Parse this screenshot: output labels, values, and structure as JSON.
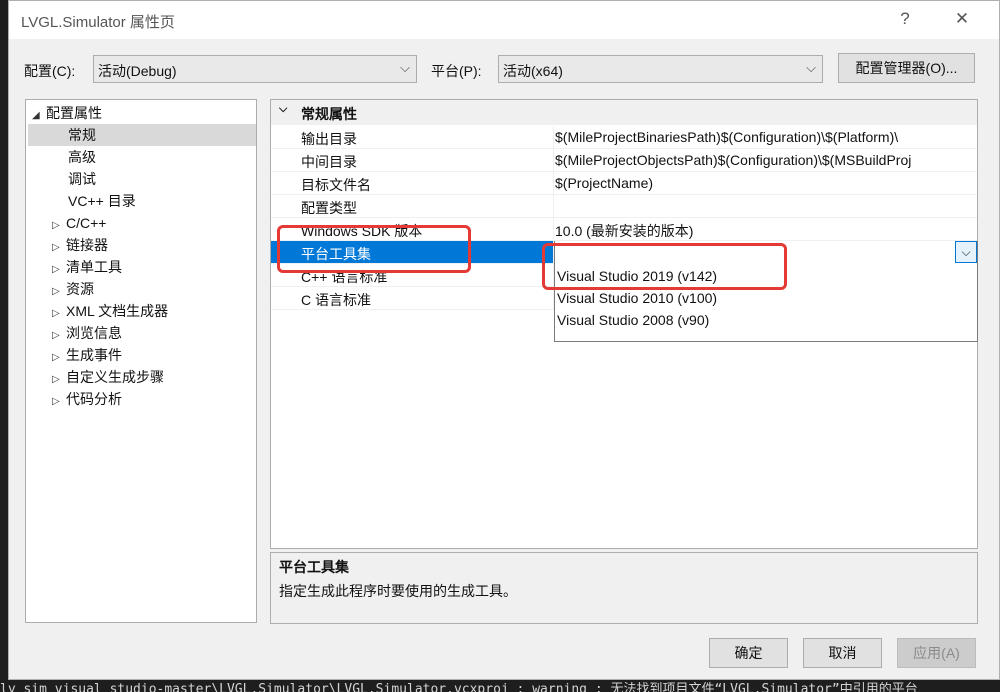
{
  "window": {
    "title": "LVGL.Simulator 属性页",
    "help_glyph": "?",
    "close_glyph": "✕"
  },
  "toolbar": {
    "config_label": "配置(C):",
    "config_value": "活动(Debug)",
    "platform_label": "平台(P):",
    "platform_value": "活动(x64)",
    "config_manager_label": "配置管理器(O)..."
  },
  "tree": {
    "root": "配置属性",
    "items": [
      {
        "label": "常规",
        "selected": true,
        "expandable": false
      },
      {
        "label": "高级",
        "expandable": false
      },
      {
        "label": "调试",
        "expandable": false
      },
      {
        "label": "VC++ 目录",
        "expandable": false
      },
      {
        "label": "C/C++",
        "expandable": true
      },
      {
        "label": "链接器",
        "expandable": true
      },
      {
        "label": "清单工具",
        "expandable": true
      },
      {
        "label": "资源",
        "expandable": true
      },
      {
        "label": "XML 文档生成器",
        "expandable": true
      },
      {
        "label": "浏览信息",
        "expandable": true
      },
      {
        "label": "生成事件",
        "expandable": true
      },
      {
        "label": "自定义生成步骤",
        "expandable": true
      },
      {
        "label": "代码分析",
        "expandable": true
      }
    ]
  },
  "grid": {
    "category": "常规属性",
    "rows": [
      {
        "name": "输出目录",
        "value": "$(MileProjectBinariesPath)$(Configuration)\\$(Platform)\\"
      },
      {
        "name": "中间目录",
        "value": "$(MileProjectObjectsPath)$(Configuration)\\$(MSBuildProj"
      },
      {
        "name": "目标文件名",
        "value": "$(ProjectName)"
      },
      {
        "name": "配置类型",
        "value": ""
      },
      {
        "name": "Windows SDK 版本",
        "value": "10.0 (最新安装的版本)"
      },
      {
        "name": "平台工具集",
        "value": ""
      },
      {
        "name": "C++ 语言标准",
        "value": ""
      },
      {
        "name": "C 语言标准",
        "value": ""
      }
    ],
    "selected_row": "平台工具集"
  },
  "dropdown": {
    "options": [
      "Visual Studio 2019 (v142)",
      "Visual Studio 2010 (v100)",
      "Visual Studio 2008 (v90)"
    ],
    "button_glyph": "⌵"
  },
  "description": {
    "title": "平台工具集",
    "text": "指定生成此程序时要使用的生成工具。"
  },
  "buttons": {
    "ok": "确定",
    "cancel": "取消",
    "apply": "应用(A)"
  },
  "console": {
    "text": "ly sim visual studio-master\\LVGL.Simulator\\LVGL.Simulator.vcxproj : warning  : 无法找到项目文件“LVGL.Simulator”中引用的平台"
  },
  "colors": {
    "selection": "#0078d7",
    "highlight_box": "#e53935"
  }
}
